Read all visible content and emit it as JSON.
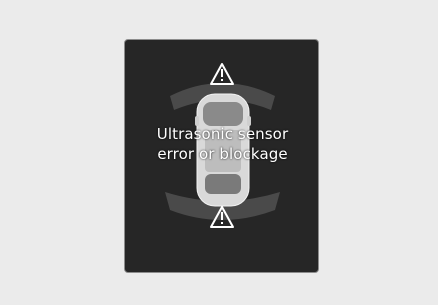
{
  "display": {
    "message_line1": "Ultrasonic sensor",
    "message_line2": "error or blockage"
  },
  "icons": {
    "front": "warning-triangle-icon",
    "rear": "warning-triangle-icon"
  },
  "colors": {
    "background": "#262626",
    "sensor_arc": "#4a4a4a",
    "icon": "#ffffff",
    "text": "#ffffff"
  }
}
